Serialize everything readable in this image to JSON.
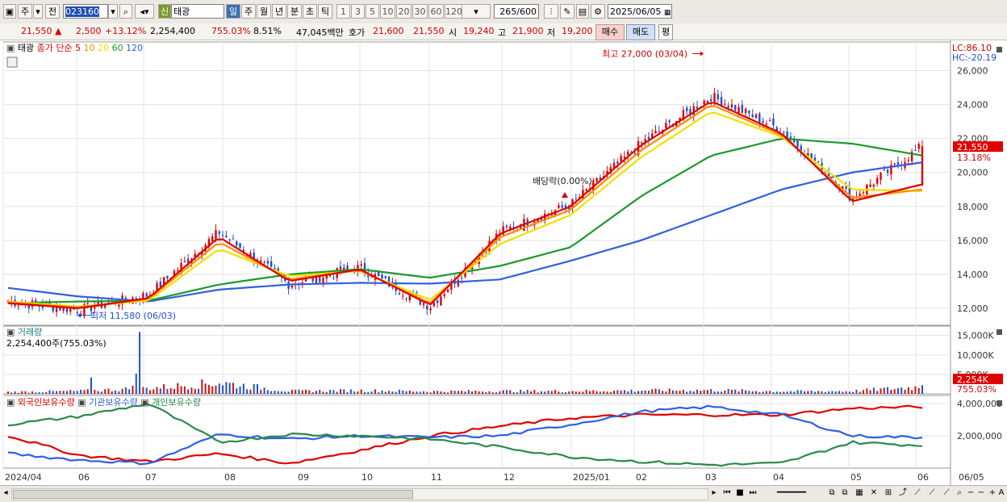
{
  "toolbar": {
    "mode_label": "주",
    "prev_label": "전",
    "stock_code": "023160",
    "badge_label": "신",
    "stock_name": "태광",
    "periods": [
      "일",
      "주",
      "월",
      "년",
      "분",
      "초",
      "틱"
    ],
    "active_period": "일",
    "intervals": [
      "1",
      "3",
      "5",
      "10",
      "20",
      "30",
      "60",
      "120"
    ],
    "count": "265",
    "count_total": "/600",
    "date": "2025/06/05"
  },
  "quote": {
    "price": "21,550",
    "change": "2,500",
    "change_pct": "+13.12%",
    "volume": "2,254,400",
    "volume_ratio": "755.03%",
    "turnover": "8.51%",
    "amount": "47,045백만",
    "ask_label": "호가",
    "ask_price": "21,600",
    "bid_price": "21,550",
    "open_label": "시",
    "open": "19,240",
    "high_label": "고",
    "high": "21,900",
    "low_label": "저",
    "low": "19,200",
    "buy_label": "매수",
    "sell_label": "매도",
    "eval_label": "평"
  },
  "price_panel": {
    "name": "태광",
    "ma_label": "종가 단순",
    "ma_periods": [
      "5",
      "10",
      "20",
      "60",
      "120"
    ],
    "ma_colors": [
      "#e00000",
      "#ff8c00",
      "#f0e000",
      "#1a9a2a",
      "#3060e0"
    ],
    "lc": "LC:86.10",
    "hc": "HC:-20.19",
    "current_price": "21,550",
    "current_pct": "13.18%",
    "high_annotation": "최고 27,000 (03/04)",
    "low_annotation": "최저 11,580 (06/03)",
    "dividend_annotation": "배당락(0.00%)",
    "y_ticks": [
      "26,000",
      "24,000",
      "22,000",
      "20,000",
      "18,000",
      "16,000",
      "14,000",
      "12,000"
    ]
  },
  "volume_panel": {
    "title": "거래량",
    "current": "2,254,400주(755.03%)",
    "y_ticks": [
      "15,000K",
      "10,000K",
      "5,000K"
    ],
    "current_label": "2,254K",
    "current_pct": "755.03%"
  },
  "holdings_panel": {
    "legend": [
      "외국인보유수량",
      "기관보유수량",
      "개인보유수량"
    ],
    "colors": [
      "#e00000",
      "#3060e0",
      "#2a8a4a"
    ],
    "y_ticks": [
      "4,000,000",
      "2,000,000"
    ]
  },
  "x_axis": {
    "labels": [
      "2024/04",
      "06",
      "07",
      "08",
      "09",
      "10",
      "11",
      "12",
      "2025/01",
      "02",
      "03",
      "04",
      "05",
      "06",
      "06/05"
    ]
  },
  "chart_data": {
    "type": "candlestick",
    "dates": [
      "2024/04",
      "06",
      "07",
      "08",
      "09",
      "10",
      "11",
      "12",
      "2025/01",
      "02",
      "03",
      "04",
      "05",
      "06"
    ],
    "close_approx": [
      12400,
      11900,
      12800,
      16500,
      13400,
      14400,
      12100,
      16500,
      18100,
      21700,
      24500,
      22500,
      18500,
      21550
    ],
    "high": {
      "value": 27000,
      "date": "03/04"
    },
    "low": {
      "value": 11580,
      "date": "06/03"
    },
    "last": {
      "open": 19240,
      "high": 21900,
      "low": 19200,
      "close": 21550
    },
    "ma5": [
      12300,
      12000,
      12600,
      16200,
      13600,
      14300,
      12200,
      16400,
      18000,
      21600,
      24200,
      22300,
      18300,
      19300
    ],
    "ma10": [
      12350,
      12050,
      12550,
      15900,
      13700,
      14250,
      12300,
      16200,
      17800,
      21300,
      24000,
      22200,
      18500,
      19000
    ],
    "ma20": [
      12400,
      12100,
      12450,
      15500,
      13900,
      14200,
      12500,
      15800,
      17500,
      20900,
      23600,
      22100,
      19000,
      18900
    ],
    "ma60": [
      12300,
      12400,
      12450,
      13400,
      14000,
      14300,
      13800,
      14500,
      15600,
      18600,
      21000,
      22000,
      21700,
      21000
    ],
    "ma120": [
      13200,
      12700,
      12400,
      13100,
      13400,
      13500,
      13450,
      13700,
      14800,
      16000,
      17500,
      19000,
      20000,
      20600
    ],
    "volume_k": [
      600,
      900,
      1800,
      3600,
      900,
      1100,
      800,
      900,
      900,
      1100,
      1200,
      800,
      900,
      2254
    ],
    "holdings": {
      "foreign": [
        2000000,
        800000,
        400000,
        900000,
        300000,
        1100000,
        2000000,
        2600000,
        3100000,
        3300000,
        3300000,
        3300000,
        3700000,
        3800000
      ],
      "institution": [
        900000,
        500000,
        300000,
        2100000,
        1800000,
        2000000,
        1900000,
        2000000,
        2700000,
        3500000,
        3800000,
        3300000,
        2000000,
        1900000
      ],
      "individual": [
        2700000,
        3200000,
        4000000,
        1600000,
        2100000,
        2000000,
        1800000,
        1300000,
        700000,
        400000,
        200000,
        300000,
        1600000,
        1400000
      ]
    },
    "ylim_price": [
      11000,
      27500
    ],
    "ylim_volume_k": [
      0,
      17000
    ],
    "ylim_holdings": [
      0,
      4400000
    ]
  }
}
